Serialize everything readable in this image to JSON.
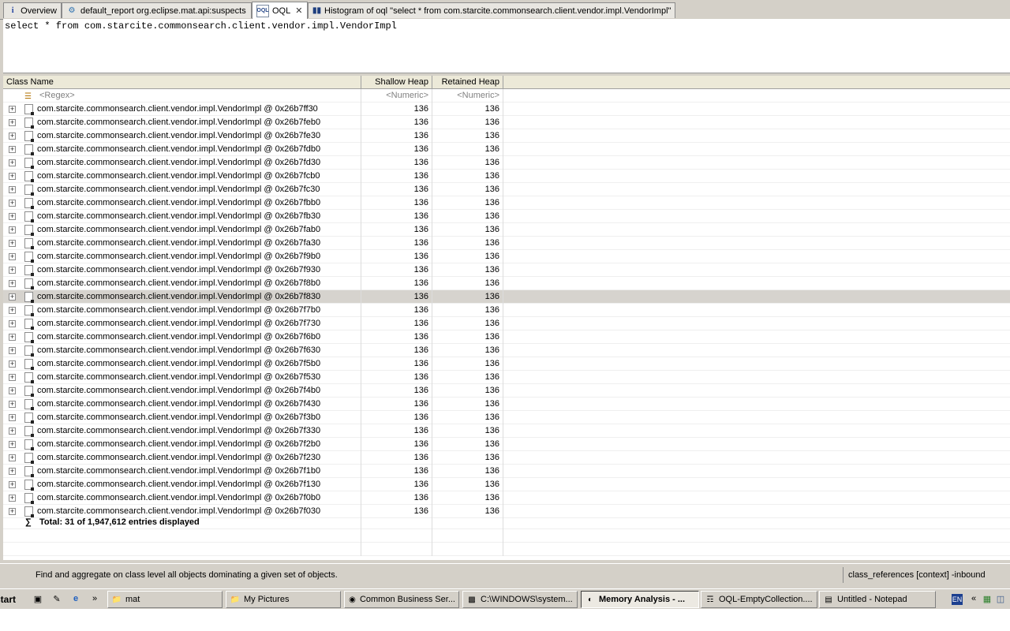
{
  "tabs": [
    {
      "label": "Overview",
      "icon": "info-icon"
    },
    {
      "label": "default_report  org.eclipse.mat.api:suspects",
      "icon": "report-icon"
    },
    {
      "label": "OQL",
      "icon": "oql-icon"
    },
    {
      "label": "Histogram of oql  \"select * from com.starcite.commonsearch.client.vendor.impl.VendorImpl\"",
      "icon": "histogram-icon"
    }
  ],
  "editor": {
    "query": "select * from com.starcite.commonsearch.client.vendor.impl.VendorImpl"
  },
  "table": {
    "columns": [
      "Class Name",
      "Shallow Heap",
      "Retained Heap"
    ],
    "filter": {
      "name": "<Regex>",
      "shallow": "<Numeric>",
      "retained": "<Numeric>"
    },
    "rows": [
      {
        "name": "com.starcite.commonsearch.client.vendor.impl.VendorImpl @ 0x26b7ff30",
        "shallow": "136",
        "retained": "136"
      },
      {
        "name": "com.starcite.commonsearch.client.vendor.impl.VendorImpl @ 0x26b7feb0",
        "shallow": "136",
        "retained": "136"
      },
      {
        "name": "com.starcite.commonsearch.client.vendor.impl.VendorImpl @ 0x26b7fe30",
        "shallow": "136",
        "retained": "136"
      },
      {
        "name": "com.starcite.commonsearch.client.vendor.impl.VendorImpl @ 0x26b7fdb0",
        "shallow": "136",
        "retained": "136"
      },
      {
        "name": "com.starcite.commonsearch.client.vendor.impl.VendorImpl @ 0x26b7fd30",
        "shallow": "136",
        "retained": "136"
      },
      {
        "name": "com.starcite.commonsearch.client.vendor.impl.VendorImpl @ 0x26b7fcb0",
        "shallow": "136",
        "retained": "136"
      },
      {
        "name": "com.starcite.commonsearch.client.vendor.impl.VendorImpl @ 0x26b7fc30",
        "shallow": "136",
        "retained": "136"
      },
      {
        "name": "com.starcite.commonsearch.client.vendor.impl.VendorImpl @ 0x26b7fbb0",
        "shallow": "136",
        "retained": "136"
      },
      {
        "name": "com.starcite.commonsearch.client.vendor.impl.VendorImpl @ 0x26b7fb30",
        "shallow": "136",
        "retained": "136"
      },
      {
        "name": "com.starcite.commonsearch.client.vendor.impl.VendorImpl @ 0x26b7fab0",
        "shallow": "136",
        "retained": "136"
      },
      {
        "name": "com.starcite.commonsearch.client.vendor.impl.VendorImpl @ 0x26b7fa30",
        "shallow": "136",
        "retained": "136"
      },
      {
        "name": "com.starcite.commonsearch.client.vendor.impl.VendorImpl @ 0x26b7f9b0",
        "shallow": "136",
        "retained": "136"
      },
      {
        "name": "com.starcite.commonsearch.client.vendor.impl.VendorImpl @ 0x26b7f930",
        "shallow": "136",
        "retained": "136"
      },
      {
        "name": "com.starcite.commonsearch.client.vendor.impl.VendorImpl @ 0x26b7f8b0",
        "shallow": "136",
        "retained": "136"
      },
      {
        "name": "com.starcite.commonsearch.client.vendor.impl.VendorImpl @ 0x26b7f830",
        "shallow": "136",
        "retained": "136",
        "selected": true
      },
      {
        "name": "com.starcite.commonsearch.client.vendor.impl.VendorImpl @ 0x26b7f7b0",
        "shallow": "136",
        "retained": "136"
      },
      {
        "name": "com.starcite.commonsearch.client.vendor.impl.VendorImpl @ 0x26b7f730",
        "shallow": "136",
        "retained": "136"
      },
      {
        "name": "com.starcite.commonsearch.client.vendor.impl.VendorImpl @ 0x26b7f6b0",
        "shallow": "136",
        "retained": "136"
      },
      {
        "name": "com.starcite.commonsearch.client.vendor.impl.VendorImpl @ 0x26b7f630",
        "shallow": "136",
        "retained": "136"
      },
      {
        "name": "com.starcite.commonsearch.client.vendor.impl.VendorImpl @ 0x26b7f5b0",
        "shallow": "136",
        "retained": "136"
      },
      {
        "name": "com.starcite.commonsearch.client.vendor.impl.VendorImpl @ 0x26b7f530",
        "shallow": "136",
        "retained": "136"
      },
      {
        "name": "com.starcite.commonsearch.client.vendor.impl.VendorImpl @ 0x26b7f4b0",
        "shallow": "136",
        "retained": "136"
      },
      {
        "name": "com.starcite.commonsearch.client.vendor.impl.VendorImpl @ 0x26b7f430",
        "shallow": "136",
        "retained": "136"
      },
      {
        "name": "com.starcite.commonsearch.client.vendor.impl.VendorImpl @ 0x26b7f3b0",
        "shallow": "136",
        "retained": "136"
      },
      {
        "name": "com.starcite.commonsearch.client.vendor.impl.VendorImpl @ 0x26b7f330",
        "shallow": "136",
        "retained": "136"
      },
      {
        "name": "com.starcite.commonsearch.client.vendor.impl.VendorImpl @ 0x26b7f2b0",
        "shallow": "136",
        "retained": "136"
      },
      {
        "name": "com.starcite.commonsearch.client.vendor.impl.VendorImpl @ 0x26b7f230",
        "shallow": "136",
        "retained": "136"
      },
      {
        "name": "com.starcite.commonsearch.client.vendor.impl.VendorImpl @ 0x26b7f1b0",
        "shallow": "136",
        "retained": "136"
      },
      {
        "name": "com.starcite.commonsearch.client.vendor.impl.VendorImpl @ 0x26b7f130",
        "shallow": "136",
        "retained": "136"
      },
      {
        "name": "com.starcite.commonsearch.client.vendor.impl.VendorImpl @ 0x26b7f0b0",
        "shallow": "136",
        "retained": "136"
      },
      {
        "name": "com.starcite.commonsearch.client.vendor.impl.VendorImpl @ 0x26b7f030",
        "shallow": "136",
        "retained": "136"
      }
    ],
    "total": "Total: 31 of 1,947,612 entries displayed"
  },
  "status": {
    "message": "Find and aggregate on class level all objects dominating a given set of objects.",
    "right": "class_references [context] -inbound"
  },
  "taskbar": {
    "start": "start",
    "items": [
      {
        "label": "mat",
        "icon": "folder-icon"
      },
      {
        "label": "My Pictures",
        "icon": "pictures-folder-icon"
      },
      {
        "label": "Common Business Ser...",
        "icon": "firefox-icon"
      },
      {
        "label": "C:\\WINDOWS\\system...",
        "icon": "cmd-icon"
      },
      {
        "label": "Memory Analysis - ...",
        "icon": "eclipse-icon",
        "active": true
      },
      {
        "label": "OQL-EmptyCollection....",
        "icon": "document-icon"
      },
      {
        "label": "Untitled - Notepad",
        "icon": "notepad-icon"
      }
    ],
    "language": "EN"
  },
  "colors": {
    "selected_row": "#d6d3ce",
    "chrome": "#d4d0c8"
  }
}
